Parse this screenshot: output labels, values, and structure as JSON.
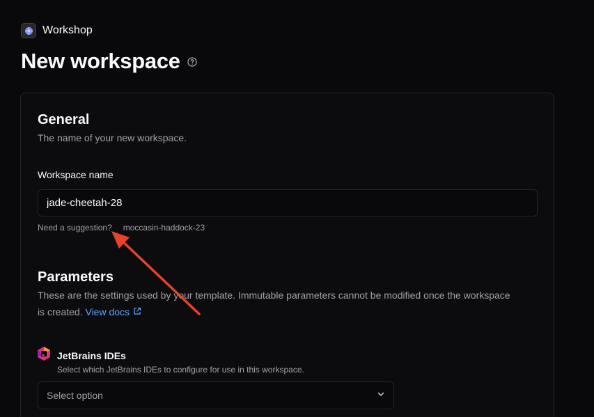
{
  "app": {
    "name": "Workshop"
  },
  "page": {
    "title": "New workspace"
  },
  "general": {
    "title": "General",
    "description": "The name of your new workspace.",
    "name_label": "Workspace name",
    "name_value": "jade-cheetah-28",
    "suggestion_prompt": "Need a suggestion?",
    "suggestion_value": "moccasin-haddock-23"
  },
  "parameters": {
    "title": "Parameters",
    "description_line1": "These are the settings used by your template. Immutable parameters cannot be modified once the workspace",
    "description_line2": "is created.",
    "docs_link": "View docs",
    "items": [
      {
        "title": "JetBrains IDEs",
        "description": "Select which JetBrains IDEs to configure for use in this workspace.",
        "placeholder": "Select option"
      }
    ]
  },
  "colors": {
    "background": "#09090b",
    "link": "#60a5fa",
    "annotation_arrow": "#e8432a"
  },
  "icons": {
    "app": "coder-logo-icon",
    "help": "help-circle-icon",
    "external": "external-link-icon",
    "parameter": "jetbrains-icon",
    "select": "chevron-down-icon"
  }
}
